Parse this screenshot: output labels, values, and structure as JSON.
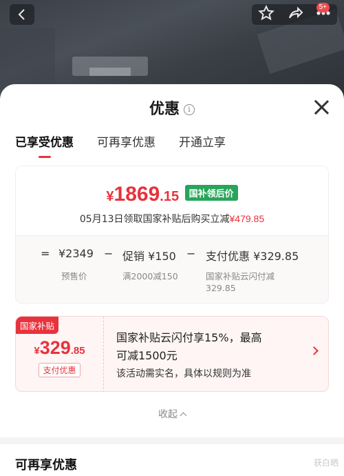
{
  "header": {
    "notification_badge": "5+",
    "icons": [
      "back-icon",
      "star-icon",
      "share-icon",
      "more-icon"
    ]
  },
  "sheet": {
    "title": "优惠",
    "info_glyph": "i"
  },
  "tabs": [
    {
      "label": "已享受优惠",
      "active": true
    },
    {
      "label": "可再享优惠",
      "active": false
    },
    {
      "label": "开通立享",
      "active": false
    }
  ],
  "price_card": {
    "currency": "¥",
    "price_int": "1869",
    "price_dec": ".15",
    "tag": "国补领后价",
    "claim_text": "05月13日领取国家补贴后购买立减",
    "claim_amount": "¥479.85",
    "calc": {
      "eq": "=",
      "presale_value": "¥2349",
      "minus1": "−",
      "promo_value": "促销 ¥150",
      "minus2": "−",
      "pay_value": "支付优惠 ¥329.85",
      "presale_label": "预售价",
      "promo_label": "满2000减150",
      "pay_label_1": "国家补贴云闪付减",
      "pay_label_2": "329.85"
    }
  },
  "coupon": {
    "flag": "国家补贴",
    "currency": "¥",
    "amount_int": "329",
    "amount_dec": ".85",
    "tag": "支付优惠",
    "line1": "国家补贴云闪付享15%，最高",
    "line2": "可减1500元",
    "note": "该活动需实名，具体以规则为准"
  },
  "collapse_label": "收起",
  "section_title": "可再享优惠",
  "watermark": "获白晒",
  "colors": {
    "accent_red": "#e8323c",
    "tag_green": "#27a55a"
  }
}
